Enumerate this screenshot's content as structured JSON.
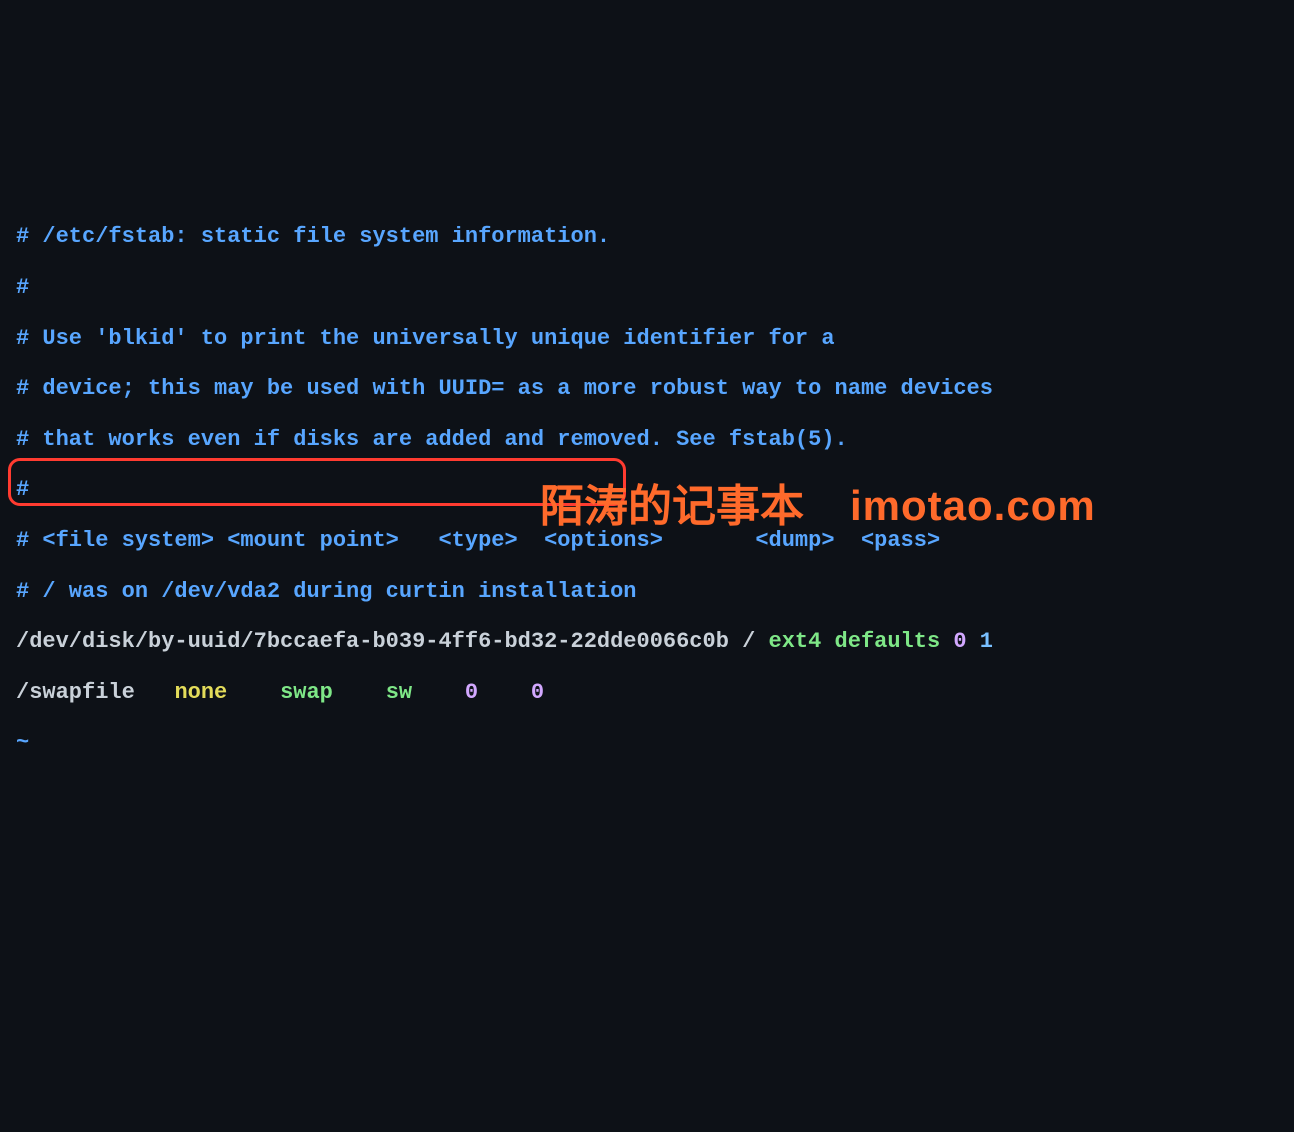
{
  "lines": {
    "l1": "# /etc/fstab: static file system information.",
    "l2": "#",
    "l3": "# Use 'blkid' to print the universally unique identifier for a",
    "l4": "# device; this may be used with UUID= as a more robust way to name devices",
    "l5": "# that works even if disks are added and removed. See fstab(5).",
    "l6": "#",
    "l7": "# <file system> <mount point>   <type>  <options>       <dump>  <pass>",
    "l8": "# / was on /dev/vda2 during curtin installation"
  },
  "entry": {
    "device": "/dev/disk/by-uuid/7bccaefa-b039-4ff6-bd32-22dde0066c0b / ",
    "fstype": "ext4 ",
    "opts": "defaults ",
    "dump": "0 ",
    "pass": "1"
  },
  "swap": {
    "file": "/swapfile   ",
    "mount": "none    ",
    "type": "swap    ",
    "opts": "sw    ",
    "dump": "0    ",
    "pass": "0"
  },
  "tilde": "~",
  "watermark": {
    "cn": "陌涛的记事本",
    "en": "imotao.com"
  },
  "highlight": {
    "left": "8",
    "top": "458",
    "width": "618",
    "height": "48"
  }
}
